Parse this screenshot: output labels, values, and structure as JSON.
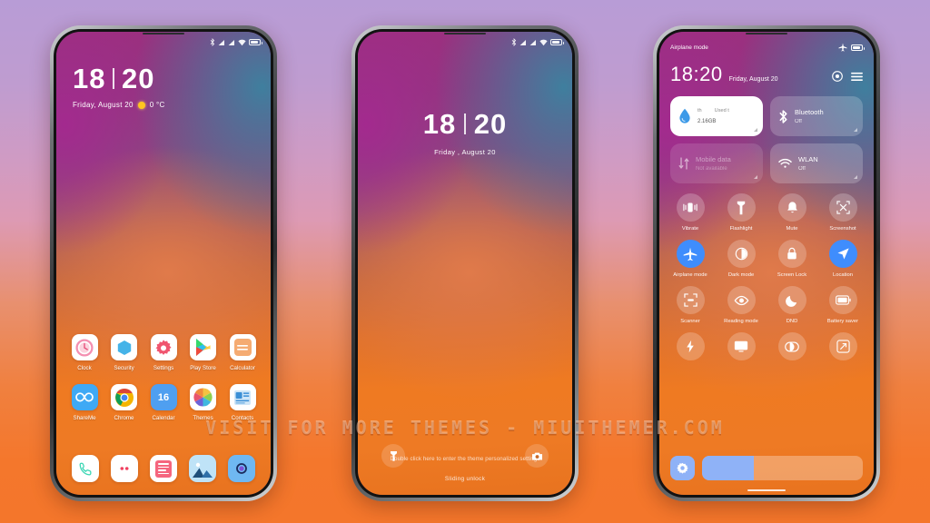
{
  "watermark": "VISIT FOR MORE THEMES - MIUITHEMER.COM",
  "home_screen": {
    "status_icons": [
      "bluetooth-icon",
      "signal-icon",
      "signal-icon",
      "wifi-icon",
      "battery-icon"
    ],
    "clock": {
      "hours": "18",
      "minutes": "20"
    },
    "date": "Friday, August  20",
    "temperature": "0 °C",
    "app_rows": [
      [
        {
          "label": "Clock",
          "icon": "clock-icon"
        },
        {
          "label": "Security",
          "icon": "security-icon"
        },
        {
          "label": "Settings",
          "icon": "settings-icon"
        },
        {
          "label": "Play Store",
          "icon": "play-store-icon"
        },
        {
          "label": "Calculator",
          "icon": "calculator-icon"
        }
      ],
      [
        {
          "label": "ShareMe",
          "icon": "shareme-icon"
        },
        {
          "label": "Chrome",
          "icon": "chrome-icon"
        },
        {
          "label": "Calendar",
          "icon": "calendar-icon",
          "day": "16"
        },
        {
          "label": "Themes",
          "icon": "themes-icon"
        },
        {
          "label": "Contacts",
          "icon": "contacts-icon"
        }
      ]
    ],
    "dock": [
      {
        "label": "Phone",
        "icon": "phone-icon"
      },
      {
        "label": "Messages",
        "icon": "messages-icon"
      },
      {
        "label": "Notes",
        "icon": "notes-icon"
      },
      {
        "label": "Gallery",
        "icon": "gallery-icon"
      },
      {
        "label": "Camera",
        "icon": "camera-icon"
      }
    ]
  },
  "lock_screen": {
    "clock": {
      "hours": "18",
      "minutes": "20"
    },
    "date": "Friday , August 20",
    "hint": "Double click here to enter the theme personalized settings",
    "slide_text": "Sliding unlock",
    "left_button": "flashlight-icon",
    "right_button": "camera-icon"
  },
  "control_center": {
    "status_left": "Airplane mode",
    "status_right_icons": [
      "airplane-icon",
      "battery-icon"
    ],
    "time": "18:20",
    "date": "Friday, August 20",
    "action_icons": [
      "record-icon",
      "menu-icon"
    ],
    "cards": [
      {
        "name": "data-usage",
        "top_left": "th",
        "top_right": "Used t",
        "value": "2.16",
        "unit": "GB",
        "style": "white"
      },
      {
        "name": "bluetooth",
        "title": "Bluetooth",
        "subtitle": "Off",
        "style": "normal",
        "icon": "bluetooth-icon"
      },
      {
        "name": "mobile-data",
        "title": "Mobile data",
        "subtitle": "Not available",
        "style": "dim",
        "icon": "mobile-data-icon"
      },
      {
        "name": "wlan",
        "title": "WLAN",
        "subtitle": "Off",
        "style": "normal",
        "icon": "wifi-icon"
      }
    ],
    "tile_rows": [
      [
        {
          "label": "Vibrate",
          "icon": "vibrate-icon",
          "on": false
        },
        {
          "label": "Flashlight",
          "icon": "flashlight-icon",
          "on": false
        },
        {
          "label": "Mute",
          "icon": "bell-icon",
          "on": false
        },
        {
          "label": "Screenshot",
          "icon": "screenshot-icon",
          "on": false
        }
      ],
      [
        {
          "label": "Airplane mode",
          "icon": "airplane-icon",
          "on": true
        },
        {
          "label": "Dark mode",
          "icon": "dark-mode-icon",
          "on": false
        },
        {
          "label": "Screen Lock",
          "icon": "lock-icon",
          "on": false
        },
        {
          "label": "Location",
          "icon": "location-icon",
          "on": true
        }
      ],
      [
        {
          "label": "Scanner",
          "icon": "scanner-icon",
          "on": false
        },
        {
          "label": "Reading mode",
          "icon": "eye-icon",
          "on": false
        },
        {
          "label": "DND",
          "icon": "moon-icon",
          "on": false
        },
        {
          "label": "Battery saver",
          "icon": "battery-saver-icon",
          "on": false
        }
      ],
      [
        {
          "label": "",
          "icon": "bolt-icon",
          "on": false
        },
        {
          "label": "",
          "icon": "cast-icon",
          "on": false
        },
        {
          "label": "",
          "icon": "contrast-icon",
          "on": false
        },
        {
          "label": "",
          "icon": "expand-icon",
          "on": false
        }
      ]
    ],
    "settings_button": "gear-icon",
    "brightness_percent": 32
  },
  "colors": {
    "accent_blue": "#3f8dfd",
    "slider_blue": "#8fb2f7",
    "bg_top": "#b89cd6",
    "bg_bottom": "#f4762b"
  }
}
